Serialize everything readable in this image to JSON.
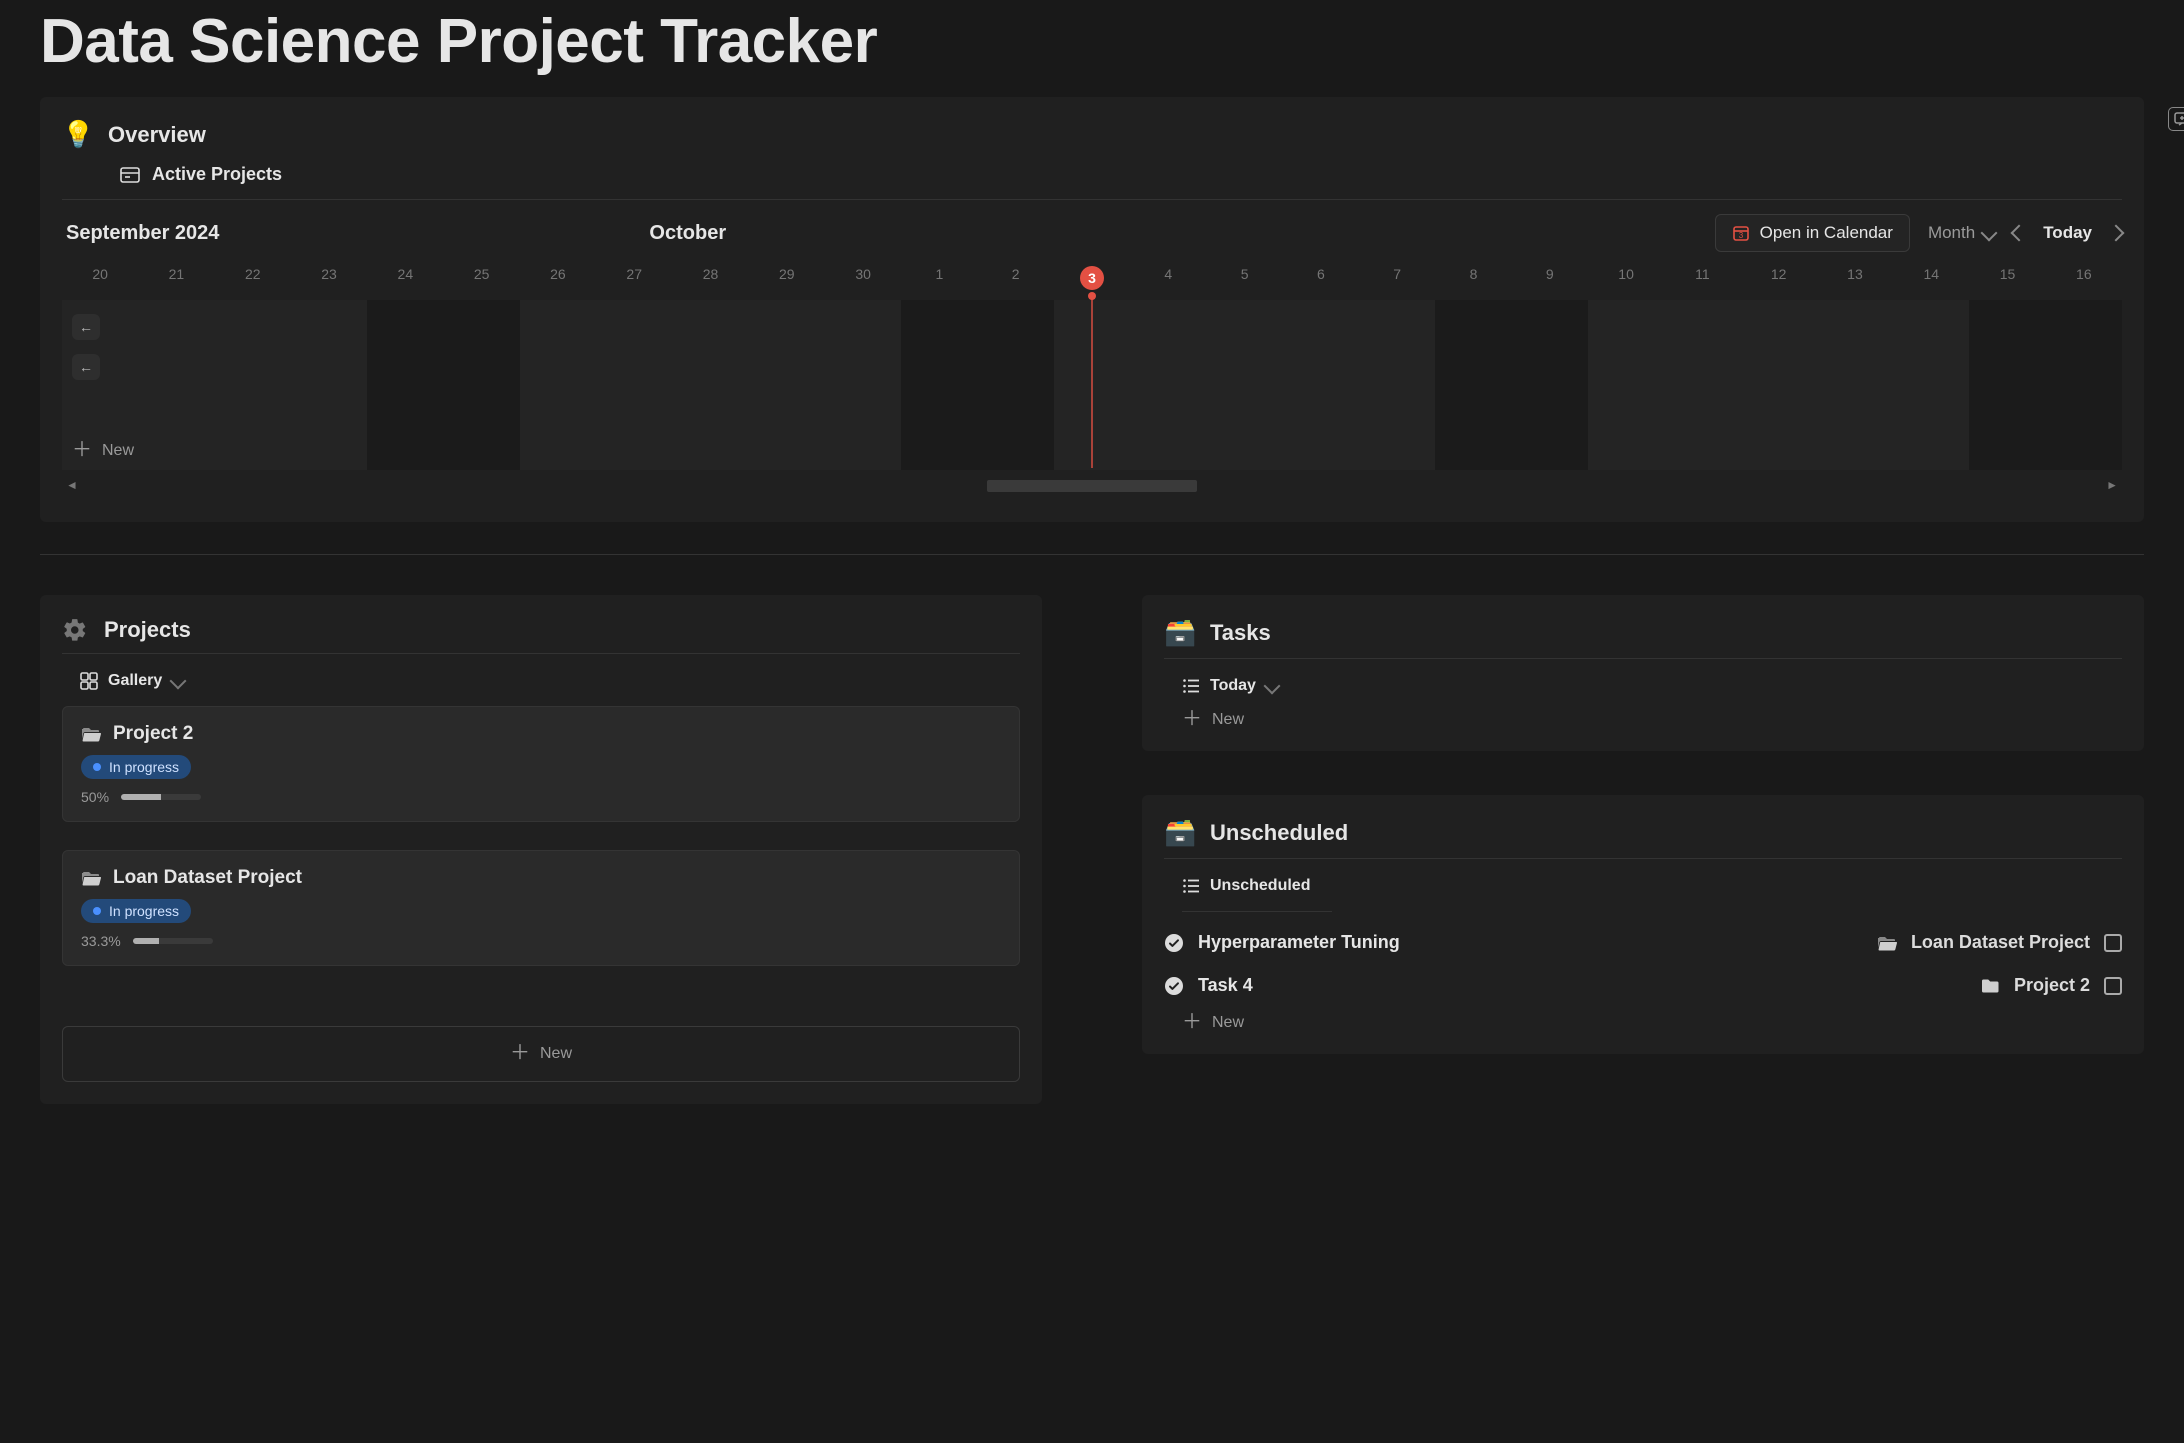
{
  "page": {
    "title": "Data Science Project Tracker"
  },
  "overview": {
    "title": "Overview",
    "active_projects_label": "Active Projects",
    "month_left": "September 2024",
    "month_right": "October",
    "open_in_calendar": "Open in Calendar",
    "range_label": "Month",
    "today_label": "Today",
    "today_day": "3",
    "new_label": "New",
    "days": [
      "20",
      "21",
      "22",
      "23",
      "24",
      "25",
      "26",
      "27",
      "28",
      "29",
      "30",
      "1",
      "2",
      "3",
      "4",
      "5",
      "6",
      "7",
      "8",
      "9",
      "10",
      "11",
      "12",
      "13",
      "14",
      "15",
      "16"
    ],
    "weekend_idx": [
      0,
      1,
      7,
      8,
      14,
      15,
      21,
      22
    ]
  },
  "projects": {
    "title": "Projects",
    "view_label": "Gallery",
    "new_btn": "New",
    "items": [
      {
        "name": "Project 2",
        "status": "In progress",
        "pct_label": "50%",
        "pct": 50
      },
      {
        "name": "Loan Dataset Project",
        "status": "In progress",
        "pct_label": "33.3%",
        "pct": 33.3
      }
    ]
  },
  "tasks": {
    "title": "Tasks",
    "view_label": "Today",
    "new_label": "New"
  },
  "unscheduled": {
    "title": "Unscheduled",
    "view_label": "Unscheduled",
    "new_label": "New",
    "items": [
      {
        "name": "Hyperparameter Tuning",
        "project": "Loan Dataset Project",
        "project_icon": "open"
      },
      {
        "name": "Task 4",
        "project": "Project 2",
        "project_icon": "closed"
      }
    ]
  }
}
